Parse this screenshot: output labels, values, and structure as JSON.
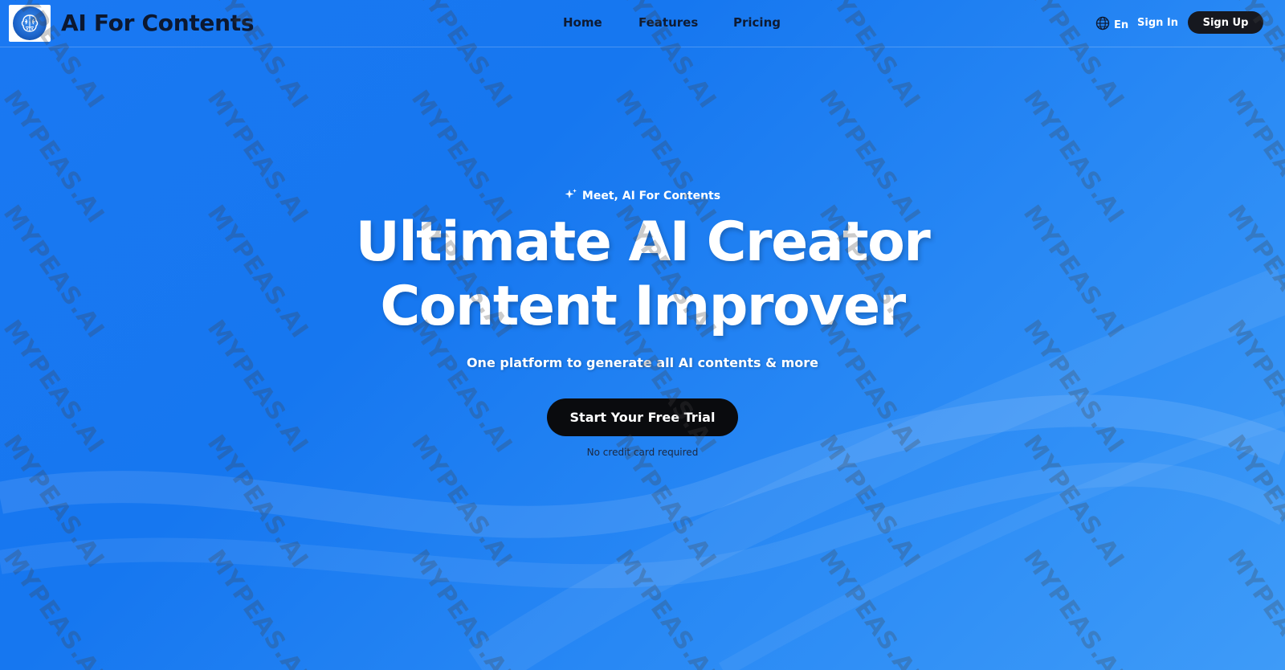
{
  "header": {
    "brand": "AI For Contents",
    "nav": [
      "Home",
      "Features",
      "Pricing"
    ],
    "language": "En",
    "sign_in": "Sign In",
    "sign_up": "Sign Up"
  },
  "hero": {
    "eyebrow": "Meet, AI For Contents",
    "headline_line1": "Ultimate AI Creator",
    "headline_line2": "Content Improver",
    "subline": "One platform to generate all AI contents & more",
    "cta": "Start Your Free Trial",
    "note": "No credit card required"
  },
  "watermark": "MYPEAS.AI",
  "colors": {
    "background": "#1a78f2",
    "cta_background": "#0a0b0e",
    "nav_text": "#0e1b33"
  },
  "icons": {
    "logo": "brain-icon",
    "language": "globe-icon",
    "eyebrow": "sparkles-icon"
  }
}
